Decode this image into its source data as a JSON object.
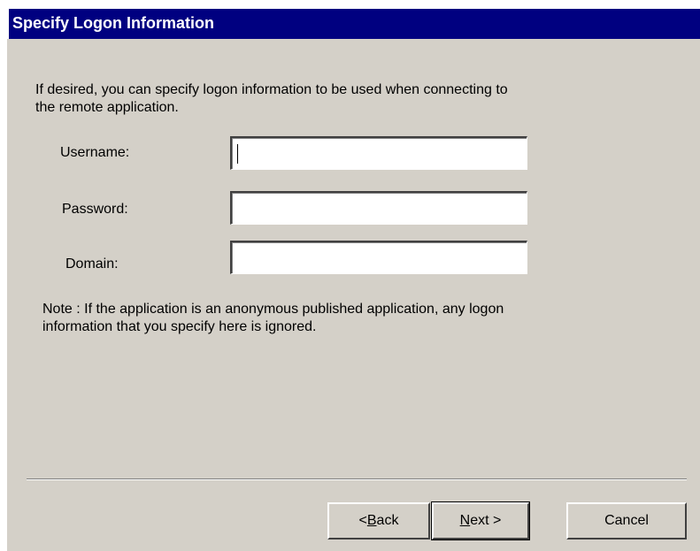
{
  "title": "Specify Logon Information",
  "intro_text": "If desired, you can specify logon information to be used when connecting to the remote application.",
  "fields": [
    {
      "label": "Username:",
      "value": ""
    },
    {
      "label": "Password:",
      "value": ""
    },
    {
      "label": "Domain:",
      "value": ""
    }
  ],
  "note": "Note : If the application is an anonymous published application, any logon information that you specify here is ignored.",
  "buttons": {
    "back_prefix": "< ",
    "back_mnemonic": "B",
    "back_rest": "ack",
    "next_mnemonic": "N",
    "next_rest": "ext >",
    "cancel": "Cancel"
  }
}
